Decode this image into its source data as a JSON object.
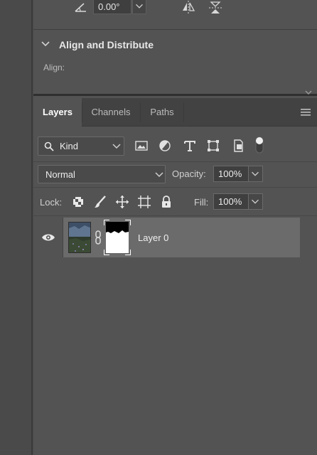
{
  "properties": {
    "angle_value": "0.00°",
    "icons": {
      "angle": "angle-icon",
      "flip_h": "flip-horizontal-icon",
      "flip_v": "flip-vertical-icon"
    }
  },
  "align": {
    "title": "Align and Distribute",
    "align_label": "Align:"
  },
  "tabs": [
    {
      "label": "Layers",
      "active": true
    },
    {
      "label": "Channels",
      "active": false
    },
    {
      "label": "Paths",
      "active": false
    }
  ],
  "filter": {
    "kind_label": "Kind",
    "icons": [
      "image-filter-icon",
      "adjustment-filter-icon",
      "type-filter-icon",
      "shape-filter-icon",
      "smart-object-filter-icon"
    ]
  },
  "blend": {
    "mode": "Normal",
    "opacity_label": "Opacity:",
    "opacity_value": "100%"
  },
  "lock": {
    "label": "Lock:",
    "fill_label": "Fill:",
    "fill_value": "100%",
    "icons": [
      "lock-transparent-icon",
      "lock-image-icon",
      "lock-position-icon",
      "lock-artboard-icon",
      "lock-all-icon"
    ]
  },
  "layers": [
    {
      "name": "Layer 0",
      "visible": true,
      "selected": true
    }
  ],
  "colors": {
    "panel_bg": "#535353",
    "selected_row": "#6b6b6b",
    "text": "#dcdcdc"
  }
}
